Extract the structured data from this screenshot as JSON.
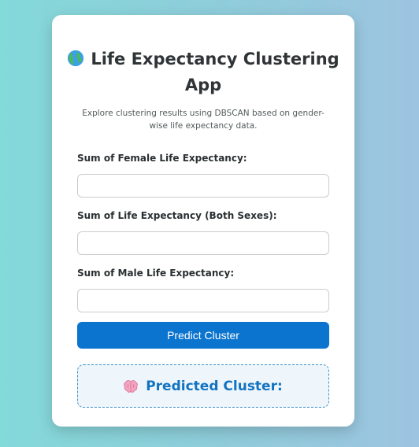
{
  "app": {
    "title": "Life Expectancy Clustering App",
    "title_icon": "globe-icon",
    "subtitle": "Explore clustering results using DBSCAN based on gender-wise life expectancy data."
  },
  "form": {
    "fields": [
      {
        "label": "Sum of Female Life Expectancy:",
        "value": "",
        "placeholder": ""
      },
      {
        "label": "Sum of Life Expectancy (Both Sexes):",
        "value": "",
        "placeholder": ""
      },
      {
        "label": "Sum of Male Life Expectancy:",
        "value": "",
        "placeholder": ""
      }
    ],
    "submit_label": "Predict Cluster"
  },
  "result": {
    "icon": "brain-icon",
    "label": "Predicted Cluster:",
    "value": ""
  },
  "colors": {
    "accent": "#0b74cf",
    "result_text": "#1373c0",
    "result_bg": "#eef6fc",
    "background_start": "#84d9d9",
    "background_end": "#9dc4e0"
  }
}
